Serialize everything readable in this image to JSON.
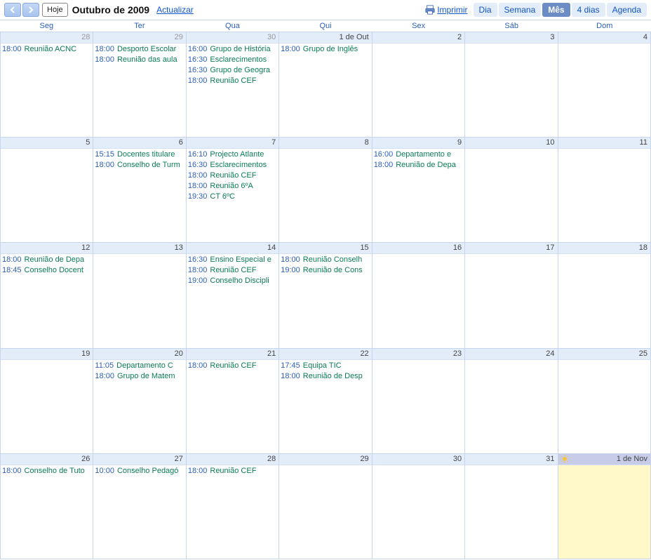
{
  "toolbar": {
    "today_label": "Hoje",
    "title": "Outubro de 2009",
    "update_label": "Actualizar",
    "print_label": "Imprimir"
  },
  "views": [
    {
      "id": "dia",
      "label": "Dia",
      "active": false
    },
    {
      "id": "semana",
      "label": "Semana",
      "active": false
    },
    {
      "id": "mes",
      "label": "Mês",
      "active": true
    },
    {
      "id": "4dias",
      "label": "4 dias",
      "active": false
    },
    {
      "id": "agenda",
      "label": "Agenda",
      "active": false
    }
  ],
  "weekdays": [
    "Seg",
    "Ter",
    "Qua",
    "Qui",
    "Sex",
    "Sáb",
    "Dom"
  ],
  "weeks": [
    [
      {
        "label": "28",
        "dim": true,
        "events": [
          {
            "time": "18:00",
            "title": "Reunião ACNC"
          }
        ]
      },
      {
        "label": "29",
        "dim": true,
        "events": [
          {
            "time": "18:00",
            "title": "Desporto Escolar"
          },
          {
            "time": "18:00",
            "title": "Reunião das aula"
          }
        ]
      },
      {
        "label": "30",
        "dim": true,
        "events": [
          {
            "time": "16:00",
            "title": "Grupo de História"
          },
          {
            "time": "16:30",
            "title": "Esclarecimentos"
          },
          {
            "time": "16:30",
            "title": "Grupo de Geogra"
          },
          {
            "time": "18:00",
            "title": "Reunião CEF"
          }
        ]
      },
      {
        "label": "1 de Out",
        "events": [
          {
            "time": "18:00",
            "title": "Grupo de Inglês"
          }
        ]
      },
      {
        "label": "2",
        "events": []
      },
      {
        "label": "3",
        "events": []
      },
      {
        "label": "4",
        "events": []
      }
    ],
    [
      {
        "label": "5",
        "events": []
      },
      {
        "label": "6",
        "events": [
          {
            "time": "15:15",
            "title": "Docentes titulare"
          },
          {
            "time": "18:00",
            "title": "Conselho de Turm"
          }
        ]
      },
      {
        "label": "7",
        "events": [
          {
            "time": "16:10",
            "title": "Projecto Atlante"
          },
          {
            "time": "16:30",
            "title": "Esclarecimentos"
          },
          {
            "time": "18:00",
            "title": "Reunião CEF"
          },
          {
            "time": "18:00",
            "title": "Reunião 6ºA"
          },
          {
            "time": "19:30",
            "title": "CT 6ºC"
          }
        ]
      },
      {
        "label": "8",
        "events": []
      },
      {
        "label": "9",
        "events": [
          {
            "time": "16:00",
            "title": "Departamento e"
          },
          {
            "time": "18:00",
            "title": "Reunião de Depa"
          }
        ]
      },
      {
        "label": "10",
        "events": []
      },
      {
        "label": "11",
        "events": []
      }
    ],
    [
      {
        "label": "12",
        "events": [
          {
            "time": "18:00",
            "title": "Reunião de Depa"
          },
          {
            "time": "18:45",
            "title": "Conselho Docent"
          }
        ]
      },
      {
        "label": "13",
        "events": []
      },
      {
        "label": "14",
        "events": [
          {
            "time": "16:30",
            "title": "Ensino Especial e"
          },
          {
            "time": "18:00",
            "title": "Reunião CEF"
          },
          {
            "time": "19:00",
            "title": "Conselho Discipli"
          }
        ]
      },
      {
        "label": "15",
        "events": [
          {
            "time": "18:00",
            "title": "Reunião Conselh"
          },
          {
            "time": "19:00",
            "title": "Reunião de Cons"
          }
        ]
      },
      {
        "label": "16",
        "events": []
      },
      {
        "label": "17",
        "events": []
      },
      {
        "label": "18",
        "events": []
      }
    ],
    [
      {
        "label": "19",
        "events": []
      },
      {
        "label": "20",
        "events": [
          {
            "time": "11:05",
            "title": "Departamento C"
          },
          {
            "time": "18:00",
            "title": "Grupo de Matem"
          }
        ]
      },
      {
        "label": "21",
        "events": [
          {
            "time": "18:00",
            "title": "Reunião CEF"
          }
        ]
      },
      {
        "label": "22",
        "events": [
          {
            "time": "17:45",
            "title": "Equipa TIC"
          },
          {
            "time": "18:00",
            "title": "Reunião de Desp"
          }
        ]
      },
      {
        "label": "23",
        "events": []
      },
      {
        "label": "24",
        "events": []
      },
      {
        "label": "25",
        "events": []
      }
    ],
    [
      {
        "label": "26",
        "events": [
          {
            "time": "18:00",
            "title": "Conselho de Tuto"
          }
        ]
      },
      {
        "label": "27",
        "events": [
          {
            "time": "10:00",
            "title": "Conselho Pedagó"
          }
        ]
      },
      {
        "label": "28",
        "events": [
          {
            "time": "18:00",
            "title": "Reunião CEF"
          }
        ]
      },
      {
        "label": "29",
        "events": []
      },
      {
        "label": "30",
        "events": []
      },
      {
        "label": "31",
        "events": []
      },
      {
        "label": "1 de Nov",
        "dim": true,
        "today": true,
        "sun": true,
        "events": []
      }
    ]
  ]
}
